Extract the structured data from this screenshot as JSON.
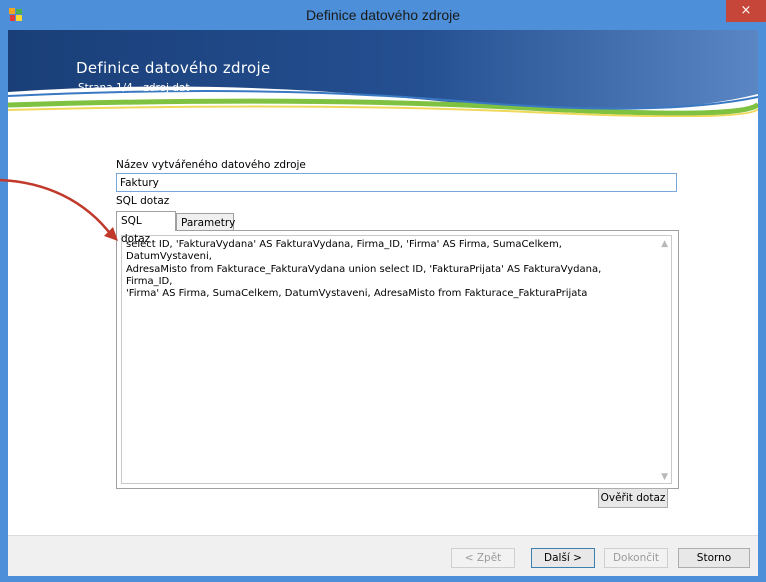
{
  "window": {
    "title": "Definice datového zdroje",
    "close_glyph": "×",
    "app_icon": "datasource-app-icon",
    "colors": {
      "titlebar": "#4d8fd8",
      "close": "#c7463a",
      "banner": "#1f4a86",
      "accent_green": "#7fc242",
      "accent_yellow": "#f0d85a"
    }
  },
  "header": {
    "title": "Definice datového zdroje",
    "subtitle": "Strana 1/4 - zdroj dat"
  },
  "form": {
    "name_label": "Název vytvářeného datového zdroje",
    "name_value": "Faktury",
    "sql_label": "SQL dotaz",
    "tabs": [
      {
        "label": "SQL dotaz",
        "active": true
      },
      {
        "label": "Parametry",
        "active": false
      }
    ],
    "sql_query": "select ID, 'FakturaVydana' AS FakturaVydana, Firma_ID, 'Firma' AS Firma, SumaCelkem, DatumVystaveni,\nAdresaMisto from Fakturace_FakturaVydana union select ID, 'FakturaPrijata' AS FakturaVydana, Firma_ID,\n'Firma' AS Firma, SumaCelkem, DatumVystaveni, AdresaMisto from Fakturace_FakturaPrijata",
    "verify_button": "Ověřit dotaz"
  },
  "footer": {
    "back": "< Zpět",
    "next": "Další >",
    "finish": "Dokončit",
    "cancel": "Storno"
  },
  "annotation": {
    "arrow_color": "#c0392b"
  }
}
